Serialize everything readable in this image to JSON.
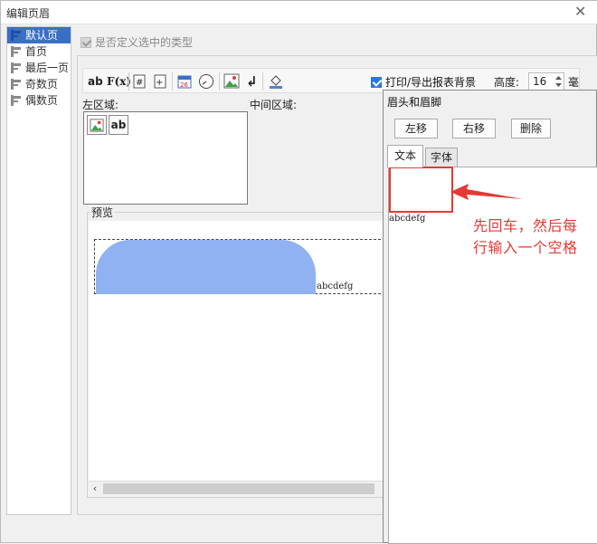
{
  "window": {
    "title": "编辑页眉"
  },
  "sidebar": {
    "items": [
      {
        "label": "默认页",
        "selected": true
      },
      {
        "label": "首页",
        "selected": false
      },
      {
        "label": "最后一页",
        "selected": false
      },
      {
        "label": "奇数页",
        "selected": false
      },
      {
        "label": "偶数页",
        "selected": false
      }
    ]
  },
  "options": {
    "custom_type_label": "是否定义选中的类型",
    "custom_type_checked": true
  },
  "toolbar": {
    "text_btn": "ab",
    "formula_btn": "F(x)",
    "print_export_label": "打印/导出报表背景",
    "print_export_checked": true,
    "height_label": "高度:",
    "height_value": "16",
    "height_unit": "毫米"
  },
  "areas": {
    "left_label": "左区域:",
    "middle_label": "中间区域:",
    "text_item_label": "ab"
  },
  "preview": {
    "label": "预览",
    "sample_text": "abcdefg"
  },
  "header_footer_dialog": {
    "title": "眉头和眉脚",
    "move_left": "左移",
    "move_right": "右移",
    "delete": "删除",
    "tabs": [
      "文本",
      "字体"
    ],
    "active_tab": 0,
    "content_text": "abcdefg"
  },
  "annotation": {
    "line1": "先回车，然后每",
    "line2": "行输入一个空格",
    "color": "#e53935"
  },
  "colors": {
    "accent": "#2f78d6",
    "selection": "#3a6fc4",
    "preview_shape": "#90b1f2"
  }
}
